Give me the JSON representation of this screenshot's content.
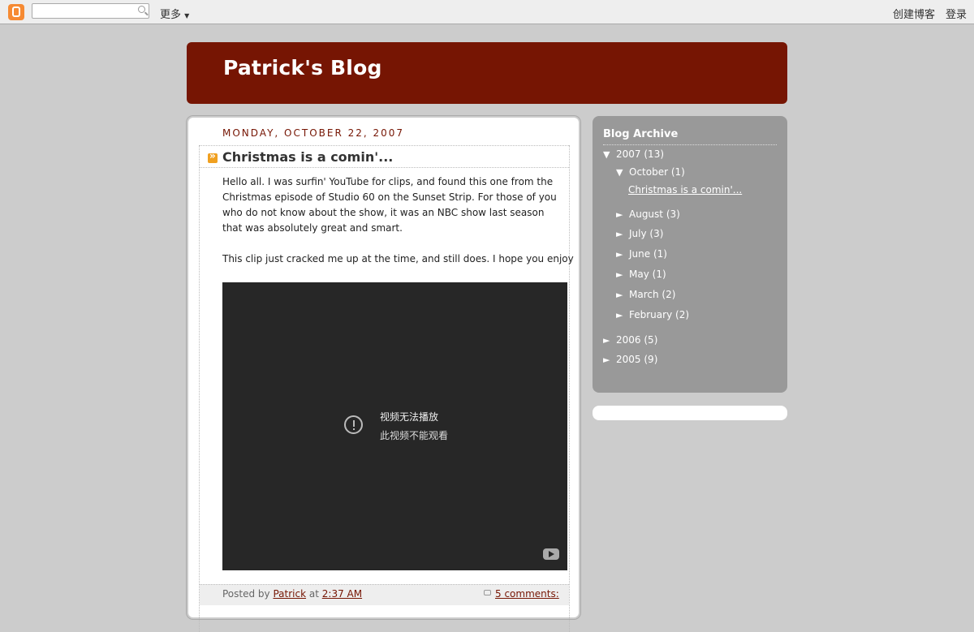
{
  "navbar": {
    "more_label": "更多",
    "create_blog": "创建博客",
    "login": "登录"
  },
  "header": {
    "title": "Patrick's Blog"
  },
  "post": {
    "date": "Monday, October 22, 2007",
    "title": "Christmas is a comin'...",
    "para1": "Hello all. I was surfin' YouTube for clips, and found this one from the Christmas episode of Studio 60 on the Sunset Strip. For those of you who do not know about the show, it was an NBC show last season that was absolutely great and smart.",
    "para2": "This clip just cracked me up at the time, and still does. I hope you enjoy",
    "video_msg1": "视频无法播放",
    "video_msg2": "此视频不能观看",
    "posted_by": "Posted by",
    "author": "Patrick",
    "at": "at",
    "time": "2:37 AM",
    "comments": "5 comments:"
  },
  "sidebar": {
    "title": "Blog Archive",
    "y2007": "2007",
    "y2007_count": "(13)",
    "october": "October",
    "october_count": "(1)",
    "october_post": "Christmas is a comin'...",
    "august": "August",
    "august_count": "(3)",
    "july": "July",
    "july_count": "(3)",
    "june": "June",
    "june_count": "(1)",
    "may": "May",
    "may_count": "(1)",
    "march": "March",
    "march_count": "(2)",
    "february": "February",
    "february_count": "(2)",
    "y2006": "2006",
    "y2006_count": "(5)",
    "y2005": "2005",
    "y2005_count": "(9)",
    "expanded_toggle": "▼",
    "collapsed_toggle": "►"
  }
}
